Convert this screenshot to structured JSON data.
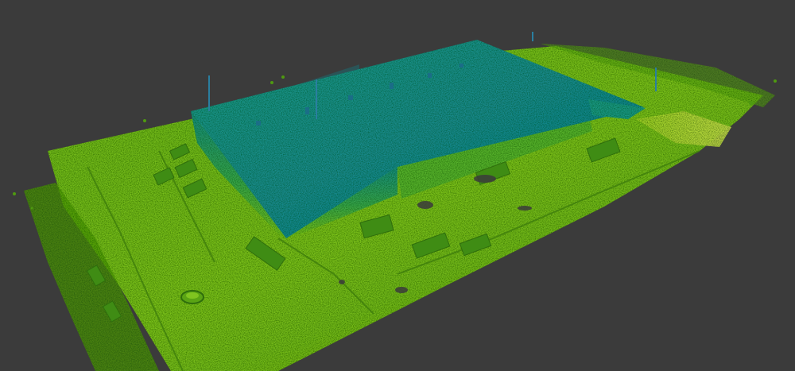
{
  "viewer": {
    "background": "#3b3b3b",
    "colormap": [
      "#4f9a10",
      "#7cc418",
      "#a8d42a",
      "#1f9a7a",
      "#1a8a8c",
      "#157f8f"
    ]
  },
  "scene": {
    "content": "lidar-point-cloud-warehouse",
    "elements": [
      "ground-lot",
      "warehouse-roof",
      "warehouse-wall",
      "parked-vehicles",
      "perimeter-fence",
      "storage-tank",
      "light-poles"
    ]
  }
}
